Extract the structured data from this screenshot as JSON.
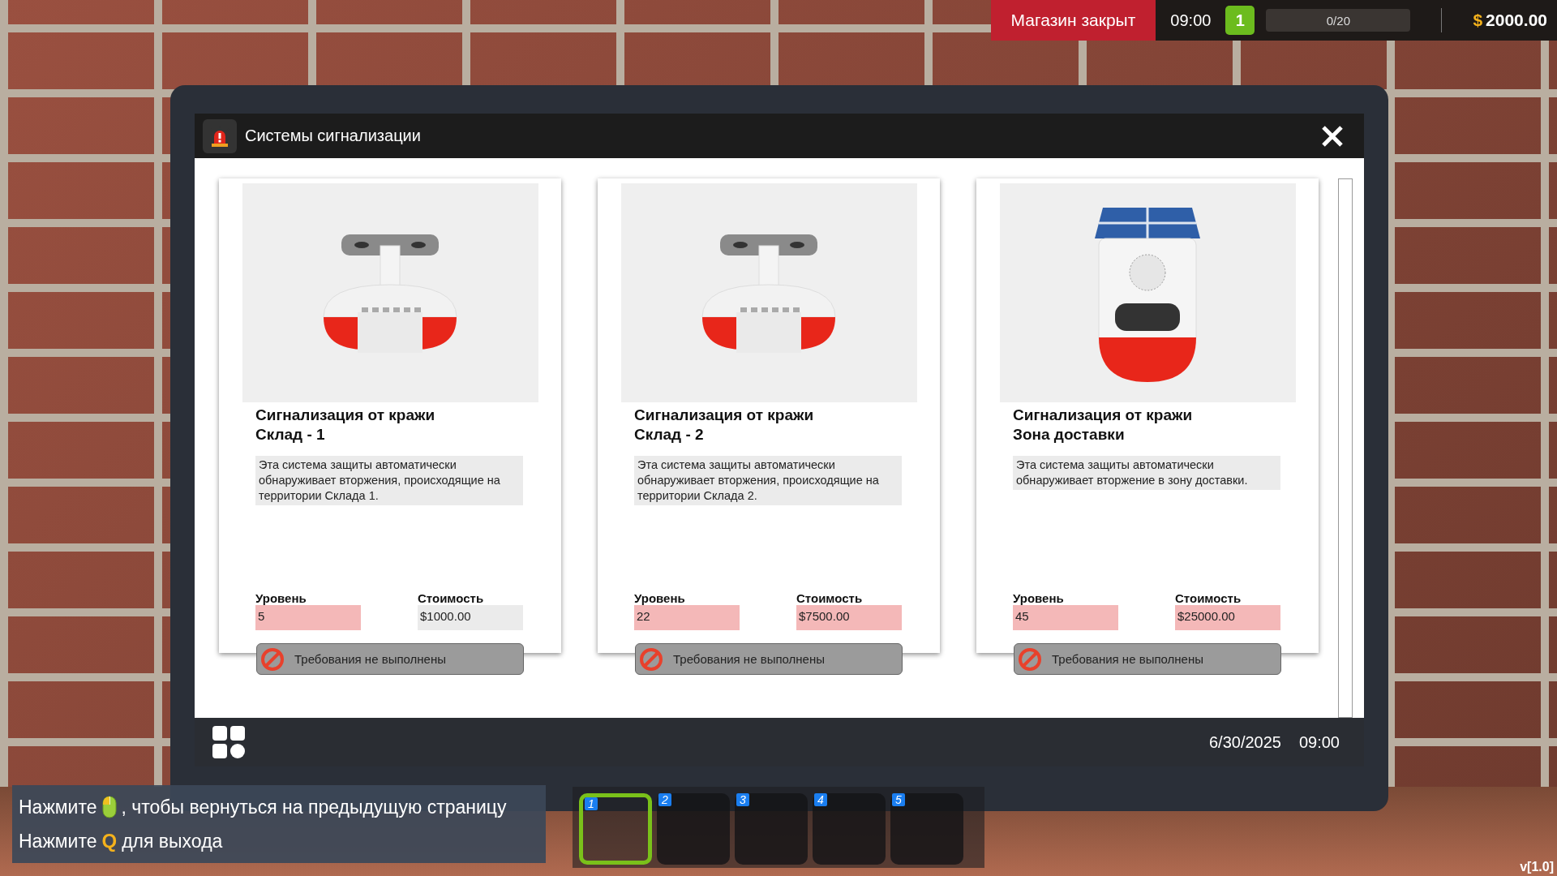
{
  "hud": {
    "store_status": "Магазин закрыт",
    "clock": "09:00",
    "level_badge": "1",
    "xp": {
      "reading": "0/20",
      "level": 0
    },
    "currency_symbol": "$",
    "money": "2000.00"
  },
  "window": {
    "title": "Системы сигнализации"
  },
  "products": [
    {
      "kind": "ceiling",
      "title": "Сигнализация от кражи",
      "subtitle": "Склад - 1",
      "description": "Эта система защиты автоматически обнаруживает вторжения, происходящие на территории Склада 1.",
      "level_label": "Уровень",
      "level_value": "5",
      "level_met": false,
      "cost_label": "Стоимость",
      "cost_value": "$1000.00",
      "cost_met": true,
      "button": "Требования не выполнены",
      "available": false
    },
    {
      "kind": "ceiling",
      "title": "Сигнализация от кражи",
      "subtitle": "Склад - 2",
      "description": "Эта система защиты автоматически обнаруживает вторжения, происходящие на территории Склада 2.",
      "level_label": "Уровень",
      "level_value": "22",
      "level_met": false,
      "cost_label": "Стоимость",
      "cost_value": "$7500.00",
      "cost_met": false,
      "button": "Требования не выполнены",
      "available": false
    },
    {
      "kind": "solar",
      "title": "Сигнализация от кражи",
      "subtitle": "Зона доставки",
      "description": "Эта система защиты автоматически обнаруживает вторжение в зону доставки.",
      "level_label": "Уровень",
      "level_value": "45",
      "level_met": false,
      "cost_label": "Стоимость",
      "cost_value": "$25000.00",
      "cost_met": false,
      "button": "Требования не выполнены",
      "available": false
    }
  ],
  "taskbar": {
    "date": "6/30/2025",
    "time": "09:00"
  },
  "hints": [
    {
      "parts": [
        {
          "kind": "text",
          "text": "Нажмите"
        },
        {
          "kind": "mouse"
        },
        {
          "kind": "text",
          "text": ", чтобы вернуться на предыдущую страницу"
        }
      ]
    },
    {
      "parts": [
        {
          "kind": "text",
          "text": "Нажмите"
        },
        {
          "kind": "key",
          "text": "Q"
        },
        {
          "kind": "text",
          "text": "для выхода"
        }
      ]
    }
  ],
  "hotbar": [
    {
      "label": "1",
      "selected": true
    },
    {
      "label": "2",
      "selected": false
    },
    {
      "label": "3",
      "selected": false
    },
    {
      "label": "4",
      "selected": false
    },
    {
      "label": "5",
      "selected": false
    }
  ],
  "version": "v[1.0]"
}
